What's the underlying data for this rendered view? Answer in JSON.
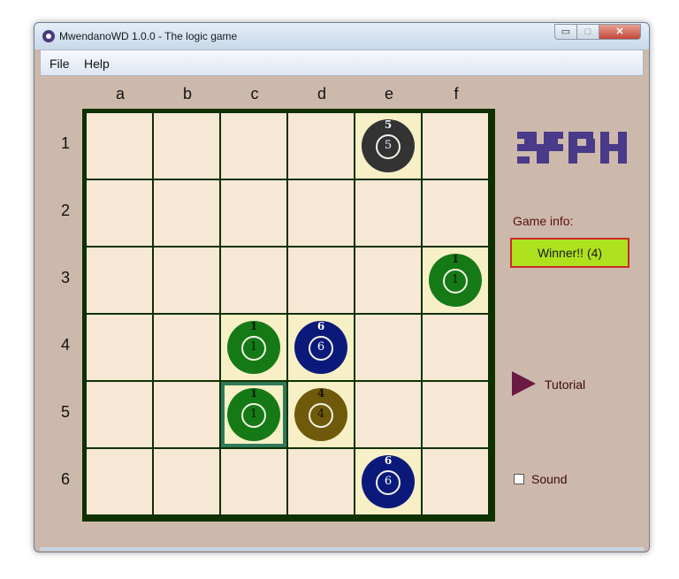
{
  "window": {
    "title": "MwendanoWD 1.0.0 - The logic game",
    "controls": {
      "minimize": "▭",
      "maximize": "□",
      "close": "✕"
    }
  },
  "menu": {
    "items": [
      "File",
      "Help"
    ]
  },
  "board": {
    "columns": [
      "a",
      "b",
      "c",
      "d",
      "e",
      "f"
    ],
    "rows": [
      "1",
      "2",
      "3",
      "4",
      "5",
      "6"
    ],
    "colors": {
      "frame": "#0f3000",
      "cell": "#f6e8d4",
      "occupied_cell": "#f7efc6",
      "selected_border": "#2e7a5a"
    },
    "pieces": [
      {
        "square": "e1",
        "col": 4,
        "row": 0,
        "top": "5",
        "center": "5",
        "color": "#333333",
        "text_color": "#eaf6ff"
      },
      {
        "square": "f3",
        "col": 5,
        "row": 2,
        "top": "1",
        "center": "1",
        "color": "#157a15",
        "text_color": "#0a1a0a"
      },
      {
        "square": "c4",
        "col": 2,
        "row": 3,
        "top": "1",
        "center": "1",
        "color": "#157a15",
        "text_color": "#0a1a0a"
      },
      {
        "square": "d4",
        "col": 3,
        "row": 3,
        "top": "6",
        "center": "6",
        "color": "#0b1a7a",
        "text_color": "#ffffff"
      },
      {
        "square": "c5",
        "col": 2,
        "row": 4,
        "top": "1",
        "center": "1",
        "color": "#157a15",
        "text_color": "#0a1a0a",
        "selected": true
      },
      {
        "square": "d5",
        "col": 3,
        "row": 4,
        "top": "4",
        "center": "4",
        "color": "#6e5a0a",
        "text_color": "#1a1200"
      },
      {
        "square": "e6",
        "col": 4,
        "row": 5,
        "top": "6",
        "center": "6",
        "color": "#0b1a7a",
        "text_color": "#ffffff"
      }
    ]
  },
  "logo": {
    "text": "YPH.",
    "color": "#4a3a8a"
  },
  "panel": {
    "game_info_label": "Game info:",
    "status": "Winner!! (4)",
    "tutorial_label": "Tutorial",
    "sound_label": "Sound",
    "sound_checked": false
  }
}
